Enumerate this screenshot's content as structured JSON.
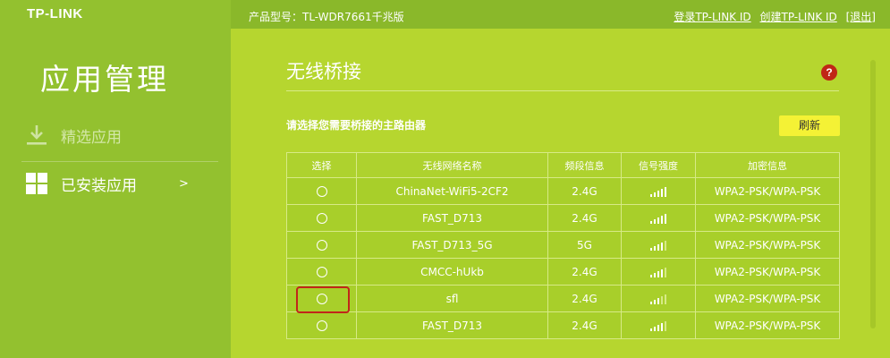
{
  "brand": {
    "logo": "TP-LINK"
  },
  "header": {
    "model": "产品型号：TL-WDR7661千兆版",
    "login": "登录TP-LINK ID",
    "create": "创建TP-LINK ID",
    "logout": "[退出]"
  },
  "sidebar": {
    "title": "应用管理",
    "items": [
      {
        "label": "精选应用",
        "icon": "download-icon"
      },
      {
        "label": "已安装应用",
        "icon": "grid-icon",
        "arrow": ">"
      }
    ]
  },
  "main": {
    "title": "无线桥接",
    "help": "?",
    "instruction": "请选择您需要桥接的主路由器",
    "refresh": "刷新",
    "columns": [
      "选择",
      "无线网络名称",
      "频段信息",
      "信号强度",
      "加密信息"
    ],
    "rows": [
      {
        "ssid": "ChinaNet-WiFi5-2CF2",
        "band": "2.4G",
        "signal_bars": 5,
        "security": "WPA2-PSK/WPA-PSK"
      },
      {
        "ssid": "FAST_D713",
        "band": "2.4G",
        "signal_bars": 5,
        "security": "WPA2-PSK/WPA-PSK"
      },
      {
        "ssid": "FAST_D713_5G",
        "band": "5G",
        "signal_bars": 4,
        "security": "WPA2-PSK/WPA-PSK"
      },
      {
        "ssid": "CMCC-hUkb",
        "band": "2.4G",
        "signal_bars": 4,
        "security": "WPA2-PSK/WPA-PSK"
      },
      {
        "ssid": "sfl",
        "band": "2.4G",
        "signal_bars": 3,
        "security": "WPA2-PSK/WPA-PSK"
      },
      {
        "ssid": "FAST_D713",
        "band": "2.4G",
        "signal_bars": 4,
        "security": "WPA2-PSK/WPA-PSK"
      }
    ],
    "highlighted_row": 4
  }
}
